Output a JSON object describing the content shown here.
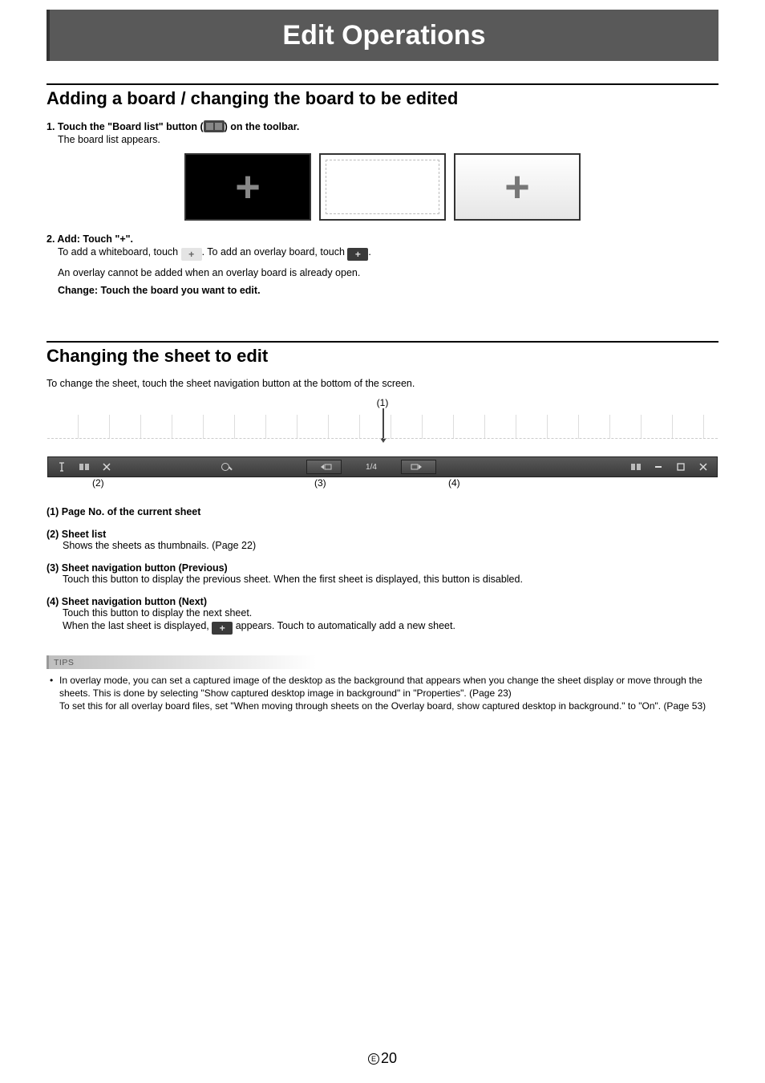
{
  "banner": {
    "title": "Edit Operations"
  },
  "section1": {
    "heading": "Adding a board / changing the board to be edited",
    "step1_prefix": "1. Touch the \"Board list\" button (",
    "step1_suffix": ") on the toolbar.",
    "step1_sub": "The board list appears.",
    "step2_label": "2. Add: Touch \"+\".",
    "step2_line_a_1": "To add a whiteboard, touch ",
    "step2_line_a_2": ". To add an overlay board, touch ",
    "step2_line_a_3": ".",
    "step2_line_b": "An overlay cannot be added when an overlay board is already open.",
    "step2_change": "Change: Touch the board you want to edit."
  },
  "section2": {
    "heading": "Changing the sheet to edit",
    "intro": "To change the sheet, touch the sheet navigation button at the bottom of the screen.",
    "callouts": {
      "c1": "(1)",
      "c2": "(2)",
      "c3": "(3)",
      "c4": "(4)"
    },
    "page_indicator": "1/4",
    "defs": {
      "d1t": "(1) Page No. of the current sheet",
      "d2t": "(2) Sheet list",
      "d2d": "Shows the sheets as thumbnails. (Page 22)",
      "d3t": "(3) Sheet navigation button (Previous)",
      "d3d": "Touch this button to display the previous sheet. When the first sheet is displayed, this button is disabled.",
      "d4t": "(4) Sheet navigation button (Next)",
      "d4d_a": "Touch this button to display the next sheet.",
      "d4d_b_1": "When the last sheet is displayed, ",
      "d4d_b_2": " appears. Touch to automatically add a new sheet."
    }
  },
  "tips": {
    "label": "TIPS",
    "body": "In overlay mode, you can set a captured image of the desktop as the background that appears when you change the sheet display or move through the sheets. This is done by selecting \"Show captured desktop image in background\" in \"Properties\". (Page 23)\nTo set this for all overlay board files, set \"When moving through sheets on the Overlay board, show captured desktop in background.\" to \"On\". (Page 53)"
  },
  "footer": {
    "e": "E",
    "num": "20"
  }
}
